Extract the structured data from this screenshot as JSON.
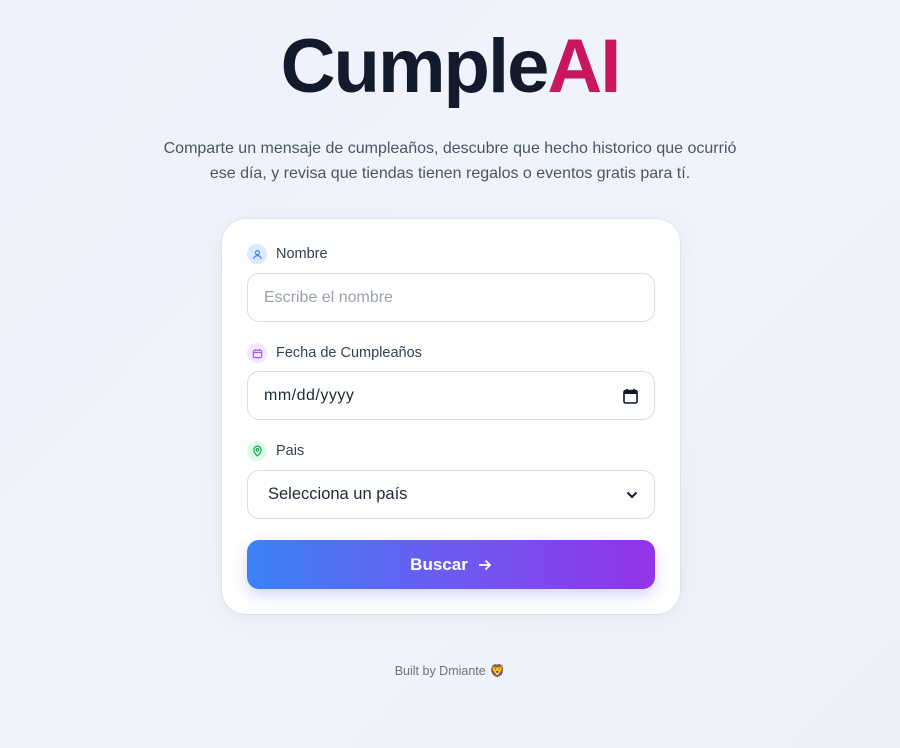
{
  "logo": {
    "part1": "Cumple",
    "part2": "AI"
  },
  "tagline": "Comparte un mensaje de cumpleaños, descubre que hecho historico que ocurrió ese día, y revisa que tiendas tienen regalos o eventos gratis para tí.",
  "form": {
    "name": {
      "label": "Nombre",
      "placeholder": "Escribe el nombre",
      "icon": "user-icon"
    },
    "birthday": {
      "label": "Fecha de Cumpleaños",
      "value": "mm/dd/yyyy",
      "icon": "calendar-icon"
    },
    "country": {
      "label": "Pais",
      "selected": "Selecciona un país",
      "icon": "map-pin-icon"
    },
    "submit_label": "Buscar"
  },
  "footer": {
    "text": "Built by Dmiante",
    "emoji": "🦁"
  },
  "colors": {
    "logo_dark": "#131a2b",
    "logo_accent": "#c8175f",
    "button_gradient_start": "#3b82f6",
    "button_gradient_end": "#9333ea"
  }
}
